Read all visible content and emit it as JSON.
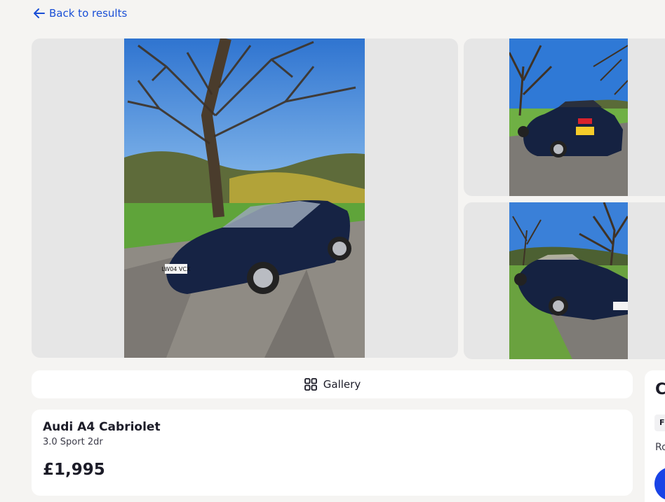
{
  "nav": {
    "back_label": "Back to results"
  },
  "gallery": {
    "button_label": "Gallery"
  },
  "listing": {
    "title": "Audi A4 Cabriolet",
    "subtitle": "3.0 Sport 2dr",
    "price": "£1,995"
  },
  "side_panel": {
    "heading": "C",
    "tag": "F",
    "text": "Ro"
  },
  "colors": {
    "accent": "#1a4fd6",
    "button_blue": "#1943e6",
    "page_bg": "#f5f4f2"
  },
  "icons": {
    "back": "arrow-left-icon",
    "gallery": "grid-icon"
  }
}
